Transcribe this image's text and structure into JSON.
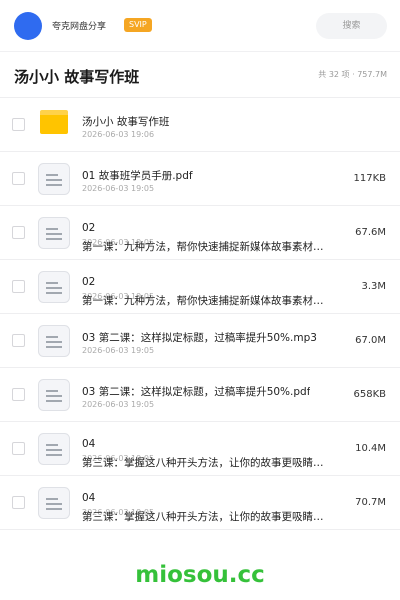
{
  "header": {
    "sharer_name": "夸克网盘分享",
    "badge": "SVIP",
    "search_placeholder": "搜索"
  },
  "folder": {
    "title": "汤小小 故事写作班",
    "meta": "共 32 项 · 757.7M"
  },
  "items": [
    {
      "type": "folder",
      "name": "汤小小 故事写作班",
      "date": "2026-06-03 19:06",
      "size": ""
    },
    {
      "type": "file",
      "name": "01 故事班学员手册.pdf",
      "date": "2026-06-03 19:05",
      "size": "117KB"
    },
    {
      "type": "file",
      "name": "02",
      "name2": "第一课：九种方法，帮你快速捕捉新媒体故事素材…",
      "date": "2026-06-03 19:05",
      "size": "67.6M"
    },
    {
      "type": "file",
      "name": "02",
      "name2": "第一课：九种方法，帮你快速捕捉新媒体故事素材…",
      "date": "2026-06-03 19:05",
      "size": "3.3M"
    },
    {
      "type": "file",
      "name": "03 第二课：这样拟定标题，过稿率提升50%.mp3",
      "date": "2026-06-03 19:05",
      "size": "67.0M"
    },
    {
      "type": "file",
      "name": "03 第二课：这样拟定标题，过稿率提升50%.pdf",
      "date": "2026-06-03 19:05",
      "size": "658KB"
    },
    {
      "type": "file",
      "name": "04",
      "name2": "第三课：掌握这八种开头方法，让你的故事更吸睛…",
      "date": "2026-06-03 19:05",
      "size": "10.4M"
    },
    {
      "type": "file",
      "name": "04",
      "name2": "第三课：掌握这八种开头方法，让你的故事更吸睛…",
      "date": "2026-06-03 19:05",
      "size": "70.7M"
    }
  ],
  "footer": {
    "brand": "miosou.cc"
  }
}
